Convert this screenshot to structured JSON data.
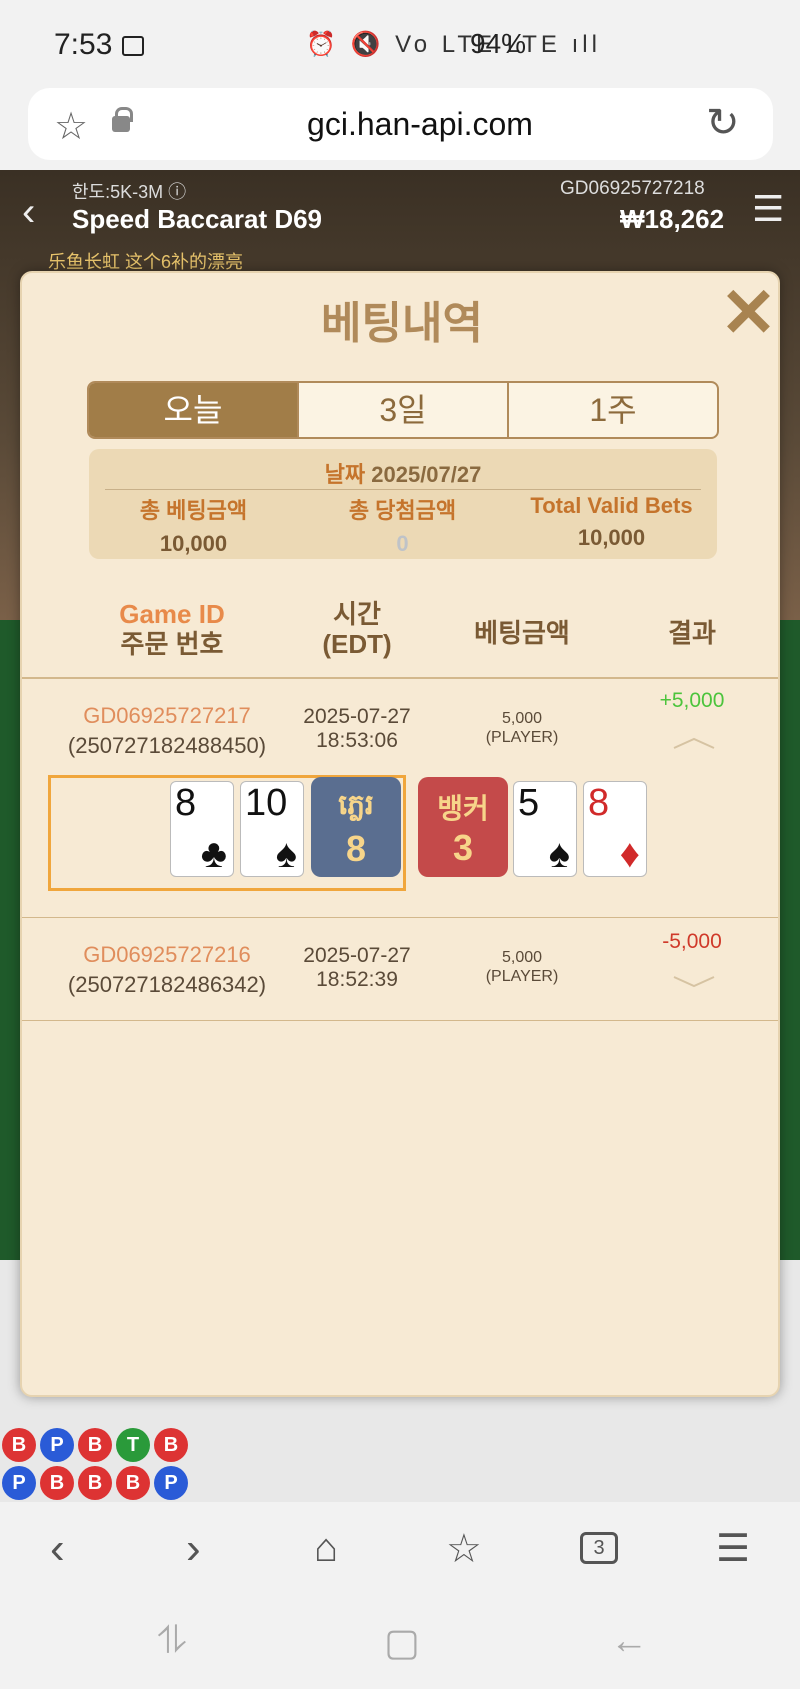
{
  "status_bar": {
    "time": "7:53",
    "icons": "⏰ 🔇 Vo LTE LTE ıll",
    "battery": "94%"
  },
  "browser": {
    "url": "gci.han-api.com",
    "tabs_count": "3"
  },
  "game": {
    "limit": "한도:5K-3M ⓘ",
    "table_name": "Speed Baccarat D69",
    "game_id": "GD06925727218",
    "balance": "₩18,262",
    "marquee": "乐鱼长虹 这个6补的漂亮",
    "bead_road": [
      [
        "B",
        "P",
        "B",
        "T",
        "B"
      ],
      [
        "P",
        "B",
        "B",
        "B",
        "P"
      ]
    ]
  },
  "modal": {
    "title": "베팅내역",
    "tabs": [
      {
        "label": "오늘",
        "active": true
      },
      {
        "label": "3일",
        "active": false
      },
      {
        "label": "1주",
        "active": false
      }
    ],
    "summary": {
      "date_label": "날짜",
      "date": "2025/07/27",
      "total_bet_label": "총 베팅금액",
      "total_bet": "10,000",
      "total_win_label": "총 당첨금액",
      "total_win": "0",
      "valid_bets_label": "Total Valid Bets",
      "valid_bets": "10,000"
    },
    "headers": {
      "game_id": "Game ID",
      "order_no": "주문 번호",
      "time": "시간",
      "time_zone": "(EDT)",
      "bet_amount": "베팅금액",
      "result": "결과"
    },
    "rows": [
      {
        "game_id": "GD06925727217",
        "order_no": "(250727182488450)",
        "date": "2025-07-27",
        "time": "18:53:06",
        "amount": "5,000",
        "side": "(PLAYER)",
        "result": "+5,000",
        "player_cards": [
          {
            "rank": "8",
            "suit": "♣"
          },
          {
            "rank": "10",
            "suit": "♠"
          }
        ],
        "player_label": "ភ្លេរ",
        "player_score": "8",
        "banker_label": "뱅커",
        "banker_score": "3",
        "banker_cards": [
          {
            "rank": "5",
            "suit": "♠"
          },
          {
            "rank": "8",
            "suit": "♦"
          }
        ]
      },
      {
        "game_id": "GD06925727216",
        "order_no": "(250727182486342)",
        "date": "2025-07-27",
        "time": "18:52:39",
        "amount": "5,000",
        "side": "(PLAYER)",
        "result": "-5,000"
      }
    ]
  },
  "icons": {
    "back": "chevron-left-icon",
    "forward": "chevron-right-icon",
    "home": "home-icon",
    "bookmarks": "bookmark-star-icon",
    "tabs": "tabs-icon",
    "menu": "menu-icon"
  },
  "colors": {
    "modal_bg": "#f7ead4",
    "accent": "#a17d48",
    "win": "#4cc43c",
    "lose": "#d03a2a"
  }
}
